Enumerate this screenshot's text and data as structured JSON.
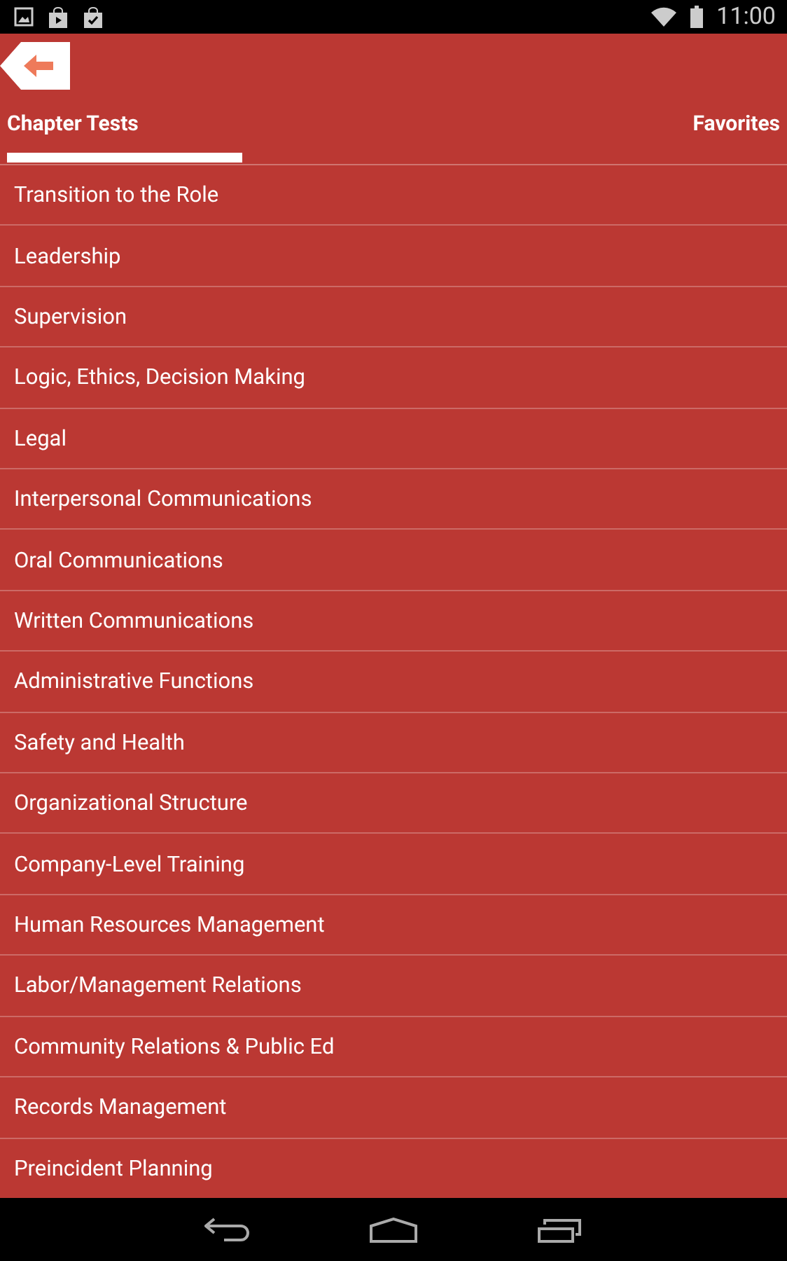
{
  "status_bar": {
    "time": "11:00"
  },
  "tabs": [
    {
      "label": "Chapter Tests",
      "selected": true
    },
    {
      "label": "Favorites",
      "selected": false
    }
  ],
  "chapters": [
    "Transition to the Role",
    "Leadership",
    "Supervision",
    "Logic, Ethics, Decision Making",
    "Legal",
    "Interpersonal Communications",
    "Oral Communications",
    "Written Communications",
    "Administrative Functions",
    "Safety and Health",
    "Organizational Structure",
    "Company-Level Training",
    "Human Resources Management",
    "Labor/Management Relations",
    "Community Relations & Public Ed",
    "Records Management",
    "Preincident Planning"
  ]
}
